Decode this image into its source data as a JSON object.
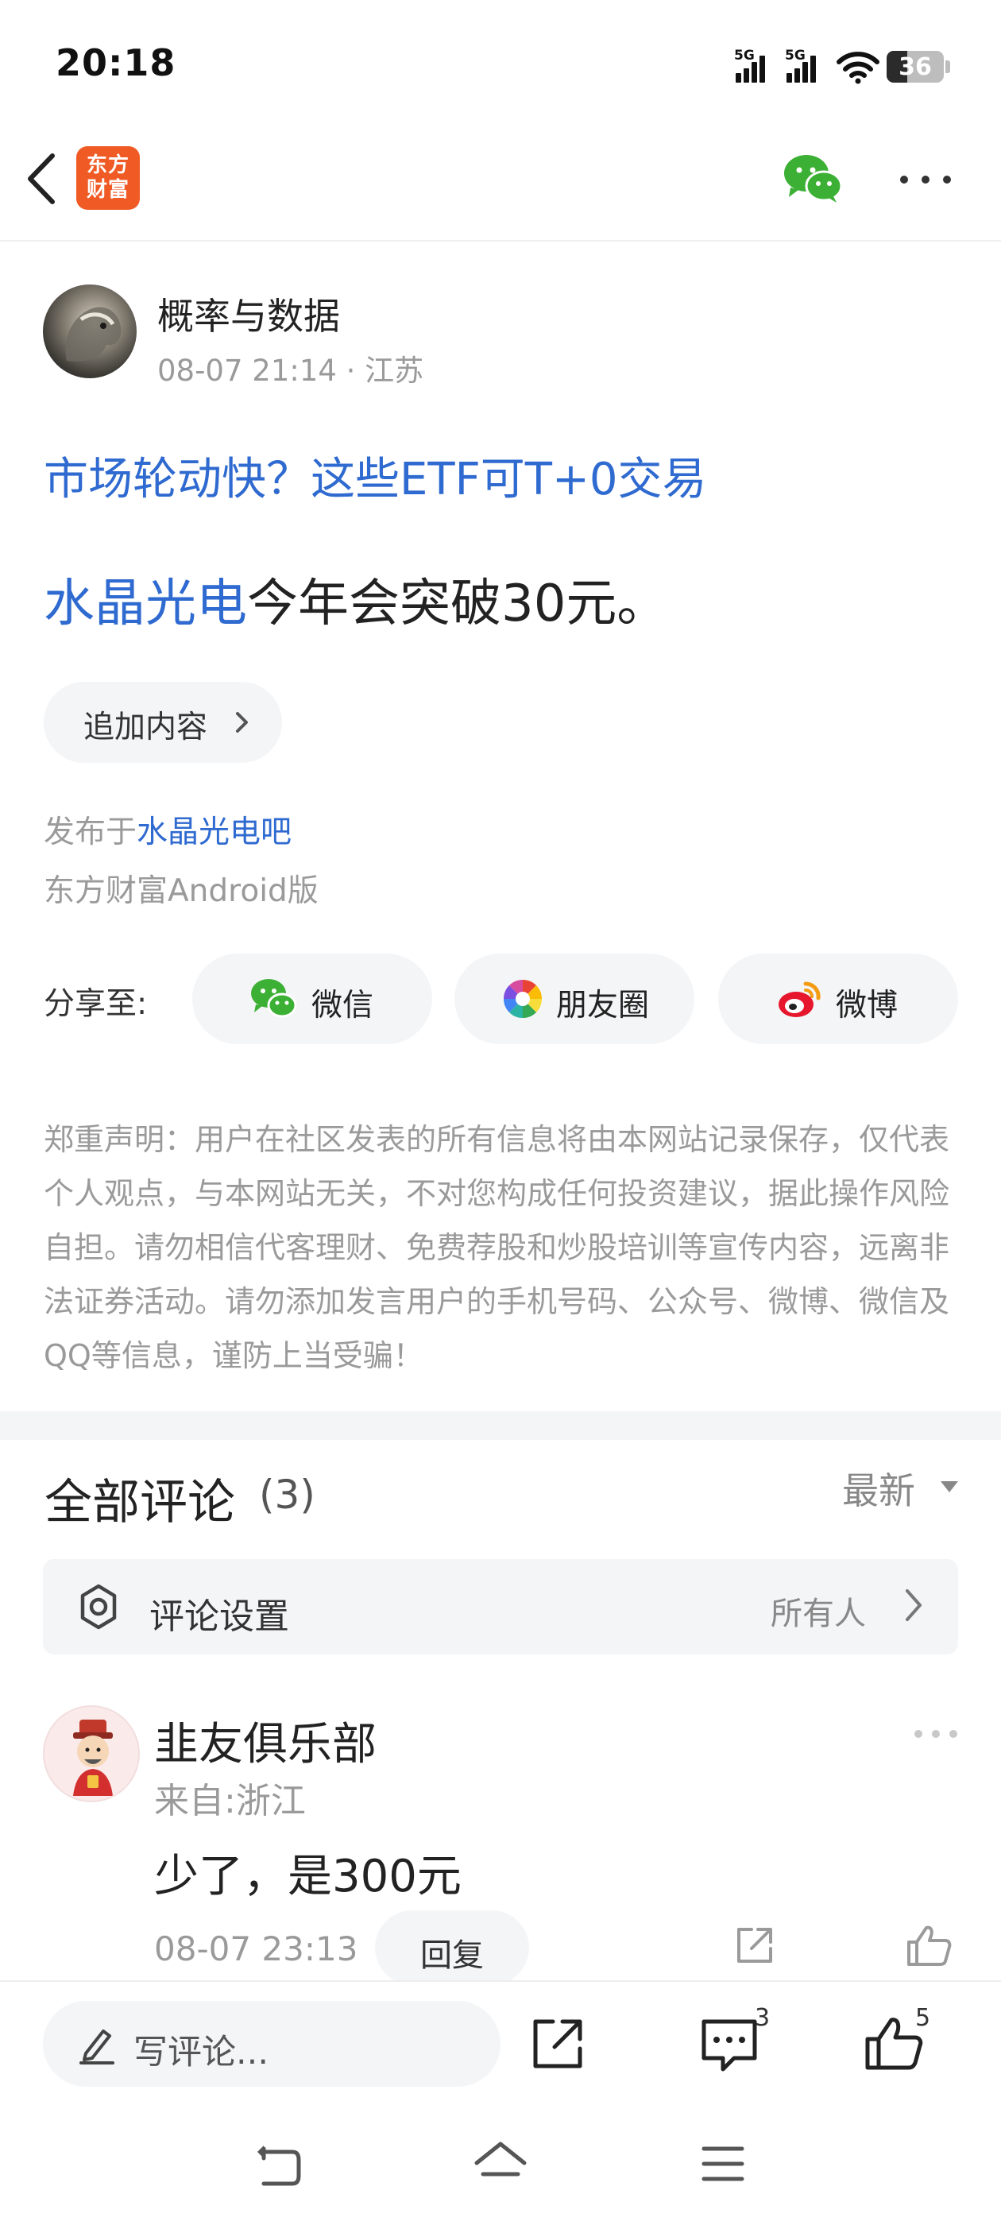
{
  "status_bar": {
    "time": "20:18",
    "sim1_label": "5G",
    "sim2_label": "5G",
    "battery_level": "36",
    "battery_fraction": 0.36
  },
  "nav": {
    "logo_text": "东方财富",
    "back_icon": "chevron-left-icon",
    "share_icon": "wechat-icon",
    "more_icon": "more-horizontal-icon"
  },
  "post": {
    "author_name": "概率与数据",
    "author_meta": "08-07 21:14 · 江苏",
    "promo_link": "市场轮动快？这些ETF可T+0交易",
    "body_stock": "水晶光电",
    "body_text": "今年会突破30元。",
    "add_content_label": "追加内容",
    "published_prefix": "发布于",
    "published_bar": "水晶光电吧",
    "client": "东方财富Android版"
  },
  "share": {
    "label": "分享至:",
    "targets": [
      {
        "label": "微信",
        "icon": "wechat-icon"
      },
      {
        "label": "朋友圈",
        "icon": "moments-icon"
      },
      {
        "label": "微博",
        "icon": "weibo-icon"
      }
    ]
  },
  "disclaimer": "郑重声明：用户在社区发表的所有信息将由本网站记录保存，仅代表个人观点，与本网站无关，不对您构成任何投资建议，据此操作风险自担。请勿相信代客理财、免费荐股和炒股培训等宣传内容，远离非法证券活动。请勿添加发言用户的手机号码、公众号、微博、微信及QQ等信息，谨防上当受骗！",
  "comments": {
    "title": "全部评论",
    "count": "(3)",
    "sort_label": "最新",
    "settings_label": "评论设置",
    "settings_value": "所有人",
    "items": [
      {
        "name": "韭友俱乐部",
        "location": "来自:浙江",
        "text": "少了，是300元",
        "time": "08-07 23:13",
        "reply_label": "回复"
      }
    ]
  },
  "bottom_bar": {
    "write_placeholder": "写评论...",
    "comment_count": "3",
    "like_count": "5"
  },
  "colors": {
    "link_blue": "#2f6ad0",
    "brand_orange": "#f05a24",
    "wechat_green": "#3cb034",
    "weibo_red": "#e6162d",
    "muted_gray": "#9a9a9a",
    "pill_bg": "#f4f5f7"
  }
}
